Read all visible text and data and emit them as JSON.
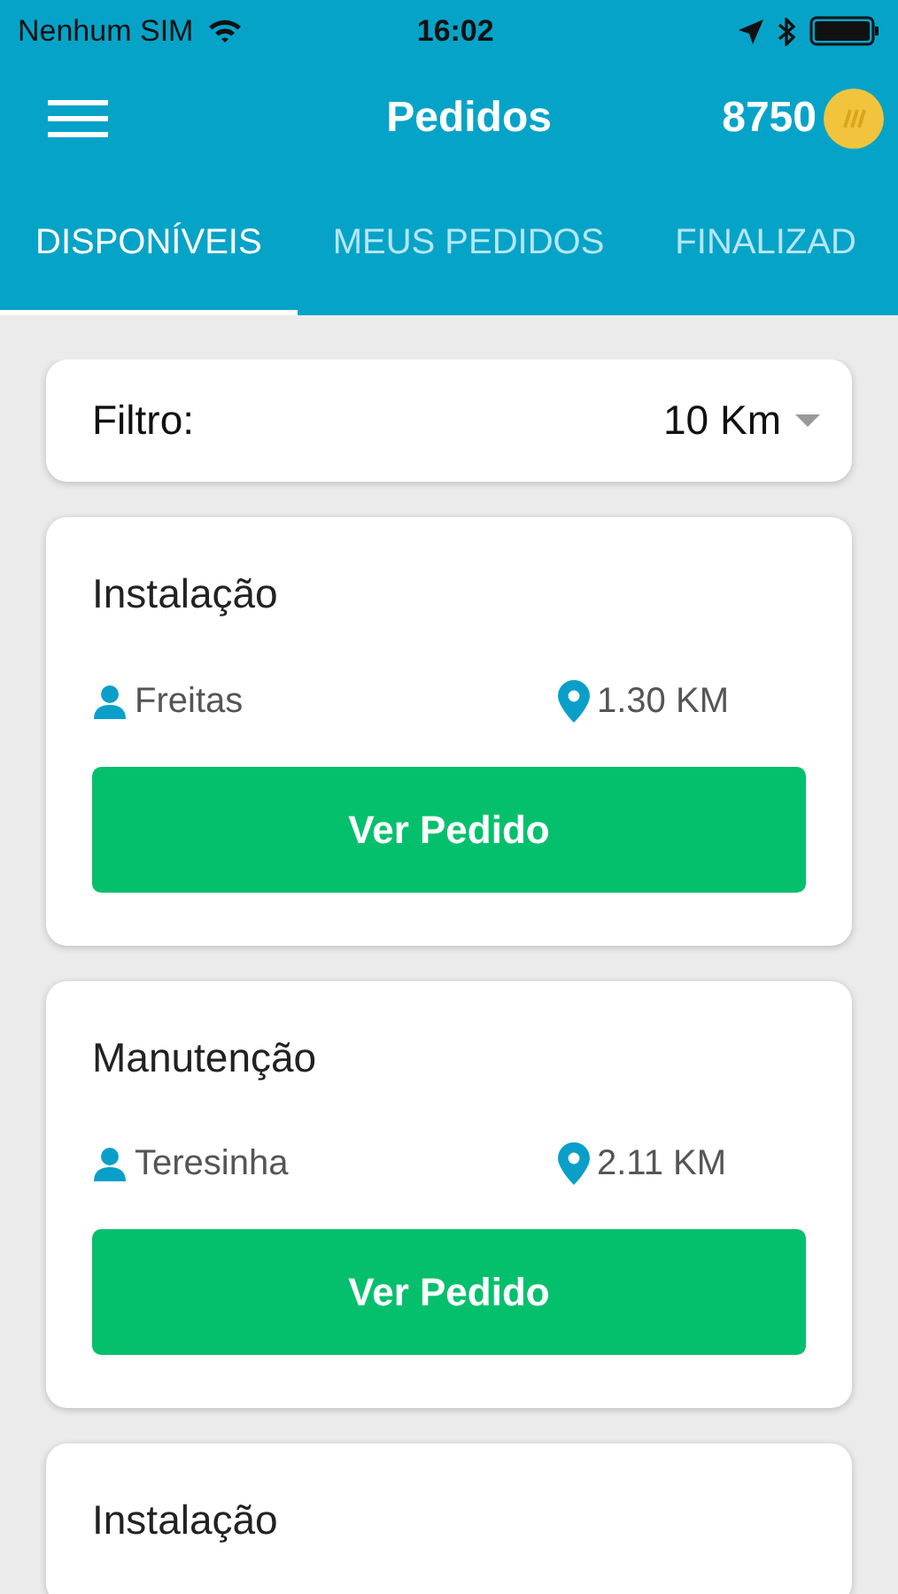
{
  "status_bar": {
    "carrier": "Nenhum SIM",
    "time": "16:02"
  },
  "header": {
    "title": "Pedidos",
    "coins": "8750"
  },
  "tabs": [
    {
      "label": "DISPONÍVEIS",
      "selected": true
    },
    {
      "label": "MEUS PEDIDOS",
      "selected": false
    },
    {
      "label": "FINALIZAD",
      "selected": false
    }
  ],
  "filter": {
    "label": "Filtro:",
    "value": "10 Km"
  },
  "orders": [
    {
      "title": "Instalação",
      "client": "Freitas",
      "distance": "1.30 KM",
      "button": "Ver Pedido"
    },
    {
      "title": "Manutenção",
      "client": "Teresinha",
      "distance": "2.11 KM",
      "button": "Ver Pedido"
    },
    {
      "title": "Instalação"
    }
  ]
}
